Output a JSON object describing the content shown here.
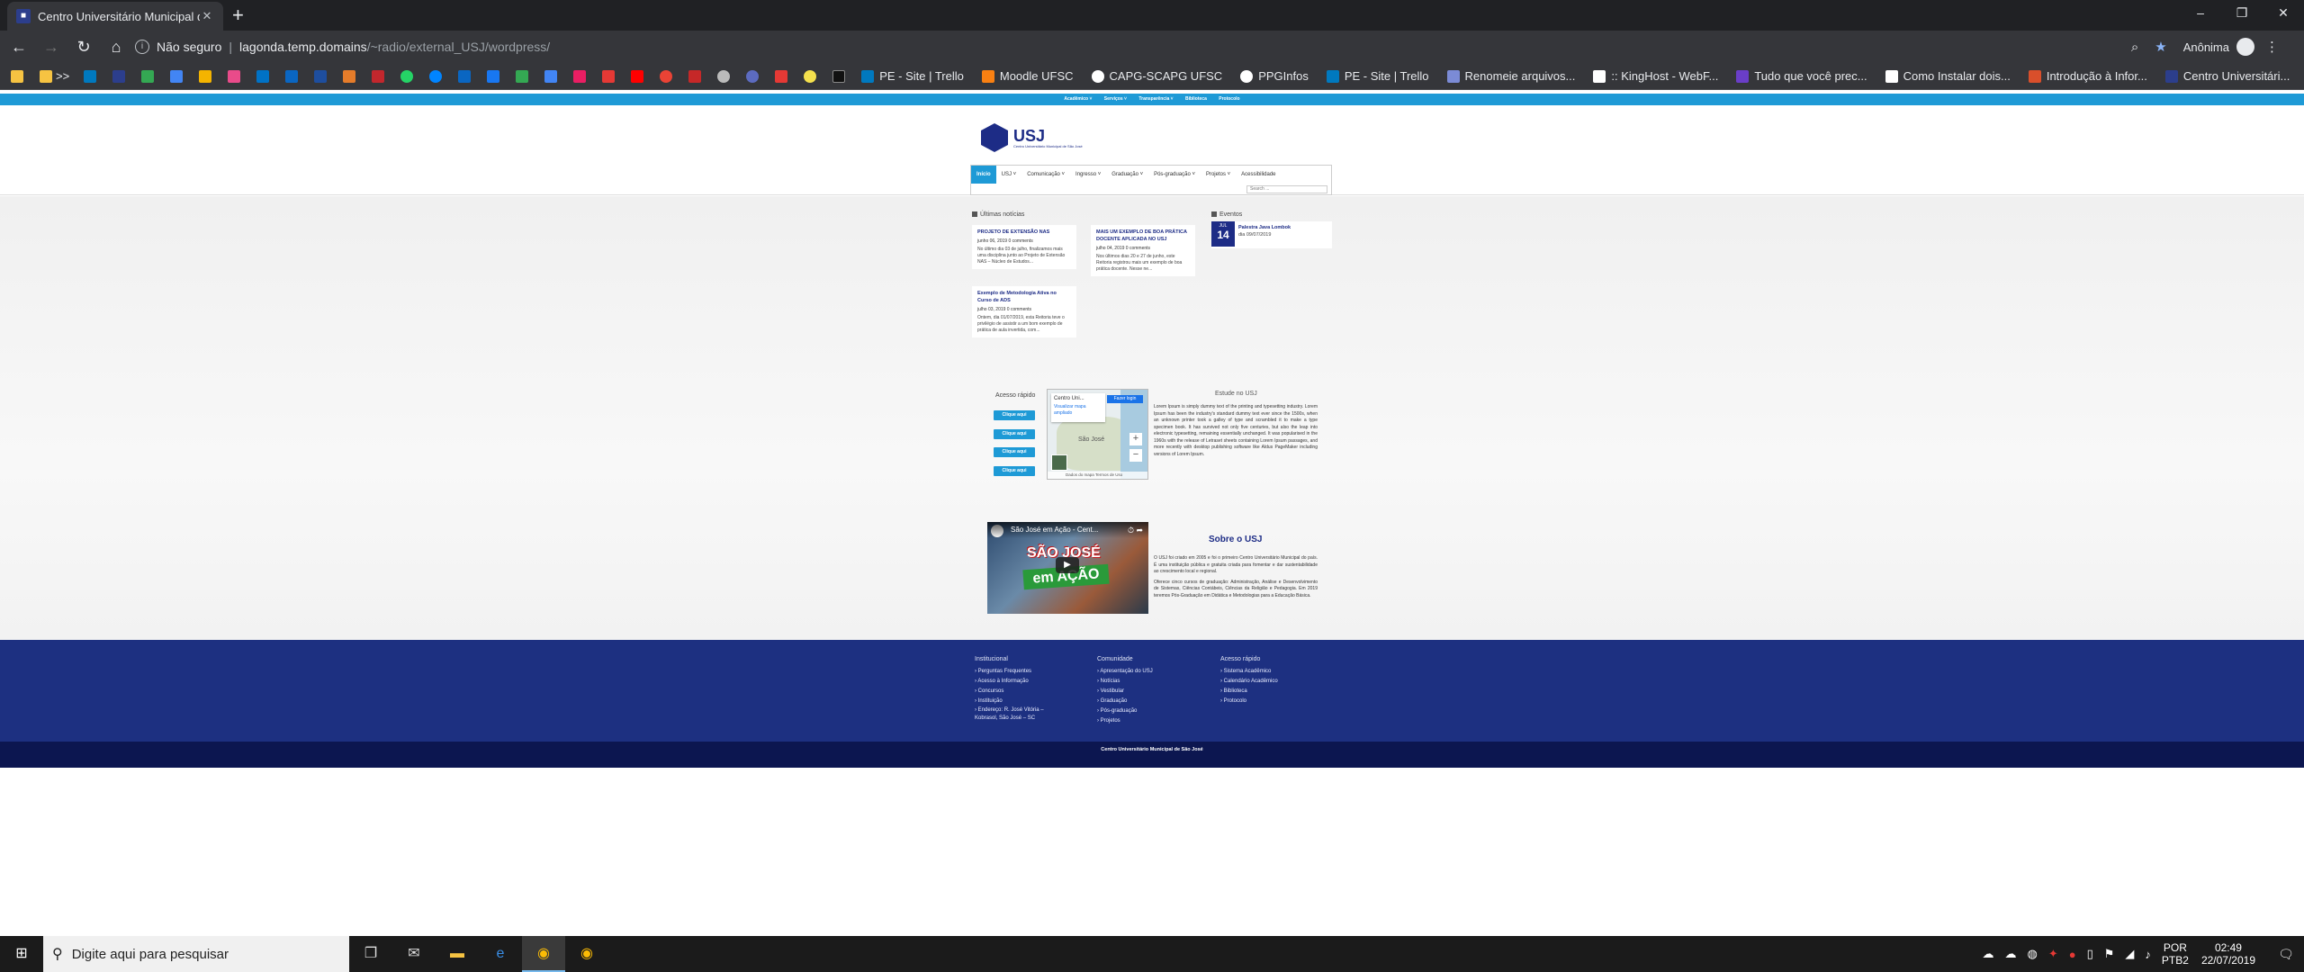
{
  "browser": {
    "tab_title": "Centro Universitário Municipal de São José",
    "new_tab": "+",
    "window_controls": [
      "–",
      "❐",
      "✕"
    ],
    "not_secure": "Não seguro",
    "url_host": "lagonda.temp.domains",
    "url_path": "/~radio/external_USJ/wordpress/",
    "profile": "Anônima",
    "bookmarks_more": ">>",
    "bookmarks": [
      {
        "label": "PE - Site | Trello",
        "color": "#0079bf"
      },
      {
        "label": "Moodle UFSC",
        "color": "#f98012"
      },
      {
        "label": "CAPG-SCAPG UFSC",
        "color": "#ffffff"
      },
      {
        "label": "PPGInfos",
        "color": "#ffffff"
      },
      {
        "label": "PE - Site | Trello",
        "color": "#0079bf"
      },
      {
        "label": "Renomeie arquivos...",
        "color": "#7b8bd6"
      },
      {
        "label": ":: KingHost - WebF...",
        "color": "#ffffff"
      },
      {
        "label": "Tudo que você prec...",
        "color": "#6a3ec8"
      },
      {
        "label": "Como Instalar dois...",
        "color": "#ffffff"
      },
      {
        "label": "Introdução à Infor...",
        "color": "#d94f2b"
      },
      {
        "label": "Centro Universitári...",
        "color": "#2c3e8c"
      }
    ]
  },
  "site": {
    "topbar_links": [
      "Acadêmico ˅",
      "Serviços ˅",
      "Transparência ˅",
      "Biblioteca",
      "Protocolo"
    ],
    "logo_text": "USJ",
    "logo_sub": "Centro Universitário Municipal de São José",
    "nav": [
      "Início",
      "USJ ˅",
      "Comunicação ˅",
      "Ingresso ˅",
      "Graduação ˅",
      "Pós-graduação ˅",
      "Projetos ˅",
      "Acessibilidade"
    ],
    "search_placeholder": "Search ...",
    "news_title": "Últimas notícias",
    "news": [
      {
        "title": "PROJETO DE EXTENSÃO NAS",
        "meta": "junho 06, 2019   0 comments",
        "excerpt": "No último dia 03 de julho, finalizamos mais uma disciplina junto ao Projeto de Extensão NAS – Núcleo de Estudos..."
      },
      {
        "title": "MAIS UM EXEMPLO DE BOA PRÁTICA DOCENTE APLICADA NO USJ",
        "meta": "julho 04, 2019   0 comments",
        "excerpt": "Nos últimos dias 20 e 27 de junho, este Reitoria registrou mais um exemplo de boa prática docente. Nesse ne..."
      },
      {
        "title": "Exemplo de Metodologia Ativa no Curso de ADS",
        "meta": "julho 03, 2019   0 comments",
        "excerpt": "Ontem, dia 01/07/2019, esta Reitoria teve o privilégio de assistir a um bom exemplo de prática de aula invertida, com..."
      }
    ],
    "events_title": "Eventos",
    "event": {
      "month": "JUL",
      "day": "14",
      "name": "Palestra Java Lombok",
      "date": "dia 09/07/2019"
    },
    "quick_title": "Acesso rápido",
    "quick_buttons": [
      "Clique aqui",
      "Clique aqui",
      "Clique aqui",
      "Clique aqui"
    ],
    "map": {
      "place": "Centro Uni...",
      "enlarge": "Visualizar mapa ampliado",
      "share": "Fazer login",
      "city": "São José",
      "footer": "Dados do mapa   Termos de Uso"
    },
    "estudo_title": "Estude no USJ",
    "estudo_text": "Lorem Ipsum is simply dummy text of the printing and typesetting industry. Lorem Ipsum has been the industry's standard dummy text ever since the 1500s, when an unknown printer took a galley of type and scrambled it to make a type specimen book. It has survived not only five centuries, but also the leap into electronic typesetting, remaining essentially unchanged. It was popularised in the 1960s with the release of Letraset sheets containing Lorem Ipsum passages, and more recently with desktop publishing software like Aldus PageMaker including versions of Lorem Ipsum.",
    "video": {
      "title": "São José em Ação - Cent...",
      "big1": "SÃO JOSÉ",
      "big2": "em AÇÃO"
    },
    "sobre_title": "Sobre o USJ",
    "sobre_p1": "O USJ foi criado em 2005 e foi o primeiro Centro Universitário Municipal do país. É uma instituição pública e gratuita criada para fomentar e dar sustentabilidade ao crescimento local e regional.",
    "sobre_p2": "Oferece cinco cursos de graduação: Administração, Análise e Desenvolvimento de Sistemas, Ciências Contábeis, Ciências da Religião e Pedagogia. Em 2019 teremos Pós-Graduação em Didática e Metodologias para a Educação Básica.",
    "footer": {
      "col1_title": "Institucional",
      "col1": [
        "Perguntas Frequentes",
        "Acesso à Informação",
        "Concursos",
        "Instituição",
        "Endereço: R. José Vitória – Kobrasol, São José – SC"
      ],
      "col2_title": "Comunidade",
      "col2": [
        "Apresentação do USJ",
        "Notícias",
        "Vestibular",
        "Graduação",
        "Pós-graduação",
        "Projetos"
      ],
      "col3_title": "Acesso rápido",
      "col3": [
        "Sistema Acadêmico",
        "Calendário Acadêmico",
        "Biblioteca",
        "Protocolo"
      ]
    },
    "copyright": "Centro Universitário Municipal de São José"
  },
  "taskbar": {
    "search_placeholder": "Digite aqui para pesquisar",
    "lang1": "POR",
    "lang2": "PTB2",
    "time": "02:49",
    "date": "22/07/2019"
  }
}
